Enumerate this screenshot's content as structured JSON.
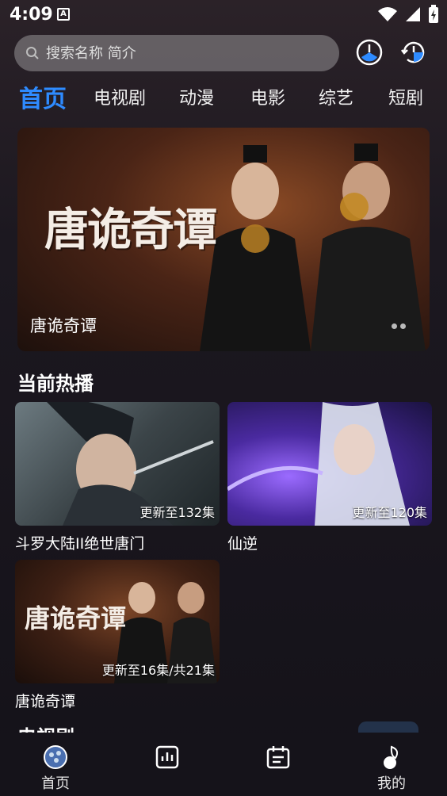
{
  "status_bar": {
    "time": "4:09"
  },
  "search": {
    "placeholder": "搜索名称 简介"
  },
  "tabs": [
    {
      "label": "首页"
    },
    {
      "label": "电视剧"
    },
    {
      "label": "动漫"
    },
    {
      "label": "电影"
    },
    {
      "label": "综艺"
    },
    {
      "label": "短剧"
    }
  ],
  "banner": {
    "title": "唐诡奇谭",
    "logo": "唐诡奇谭"
  },
  "section": {
    "title": "当前热播"
  },
  "cards": [
    {
      "name": "斗罗大陆II绝世唐门",
      "badge": "更新至132集"
    },
    {
      "name": "仙逆",
      "badge": "更新至120集"
    },
    {
      "name": "唐诡奇谭",
      "badge": "更新至16集/共21集"
    }
  ],
  "next_section": {
    "title": "电视剧"
  },
  "bottom_nav": [
    {
      "label": "首页"
    },
    {
      "label": ""
    },
    {
      "label": ""
    },
    {
      "label": "我的"
    }
  ],
  "colors": {
    "accent": "#2e8bff",
    "background": "#1a1420"
  }
}
